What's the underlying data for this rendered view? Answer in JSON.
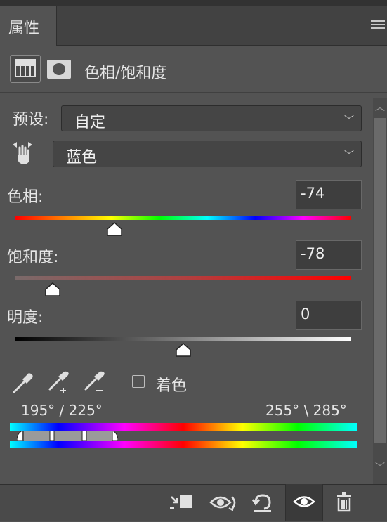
{
  "panel": {
    "tab_title": "属性",
    "adjustment_title": "色相/饱和度"
  },
  "preset": {
    "label": "预设:",
    "value": "自定"
  },
  "channel": {
    "value": "蓝色"
  },
  "hue": {
    "label": "色相:",
    "value": "-74",
    "range": [
      -180,
      180
    ]
  },
  "saturation": {
    "label": "饱和度:",
    "value": "-78",
    "range": [
      -100,
      100
    ]
  },
  "lightness": {
    "label": "明度:",
    "value": "0",
    "range": [
      -100,
      100
    ]
  },
  "colorize": {
    "label": "着色",
    "checked": false
  },
  "color_range": {
    "left_text": "195° / 225°",
    "right_text": "255° \\ 285°"
  },
  "icons": {
    "menu": "hamburger-menu-icon",
    "adjustment": "hue-saturation-layer-icon",
    "mask": "layer-mask-icon",
    "hand": "targeted-adjustment-hand-icon",
    "eyedropper": "eyedropper-icon",
    "eyedropper_add": "eyedropper-plus-icon",
    "eyedropper_subtract": "eyedropper-minus-icon",
    "clip": "clip-to-layer-icon",
    "view_previous": "view-previous-state-icon",
    "reset": "reset-icon",
    "visibility": "eye-icon",
    "delete": "trash-icon"
  },
  "colors": {
    "panel_bg": "#535353",
    "tabbar_bg": "#424242",
    "field_bg": "#454545"
  }
}
